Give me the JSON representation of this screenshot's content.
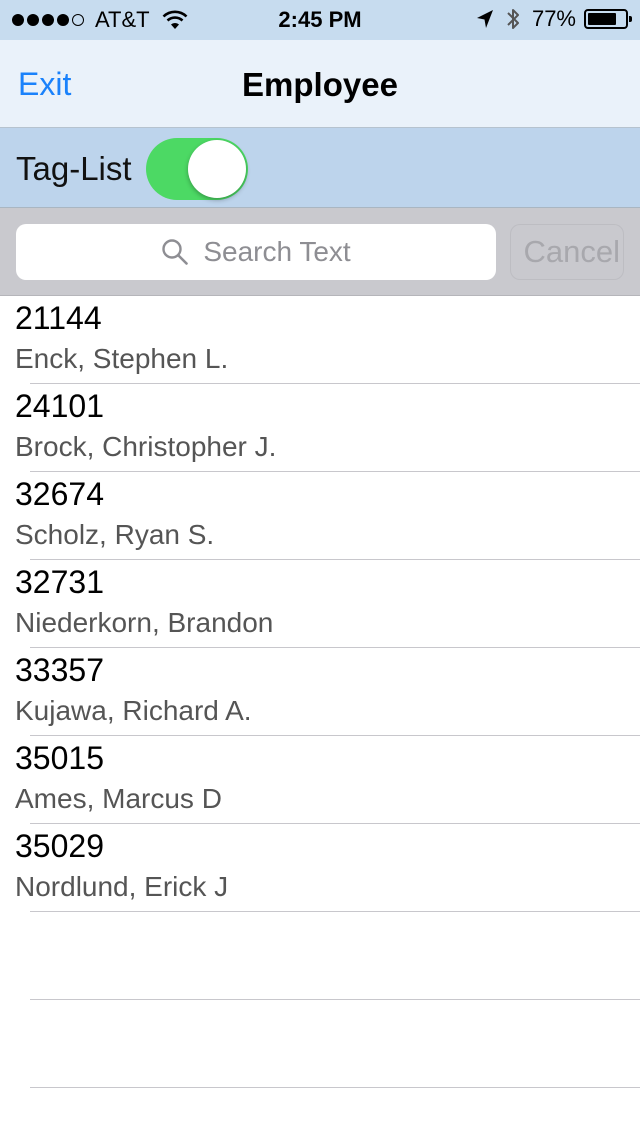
{
  "status_bar": {
    "carrier": "AT&T",
    "signal_bars_filled": 4,
    "signal_bars_total": 5,
    "time": "2:45 PM",
    "battery_percent": "77%",
    "icons": [
      "wifi-icon",
      "location-arrow-icon",
      "bluetooth-icon",
      "battery-icon"
    ]
  },
  "nav": {
    "exit_label": "Exit",
    "title": "Employee"
  },
  "tag_list": {
    "label": "Tag-List",
    "toggle_on": true,
    "toggle_color": "#4cd964"
  },
  "search": {
    "placeholder": "Search Text",
    "cancel_label": "Cancel",
    "icon": "search-icon"
  },
  "employees": [
    {
      "id": "21144",
      "name": "Enck, Stephen L."
    },
    {
      "id": "24101",
      "name": "Brock, Christopher J."
    },
    {
      "id": "32674",
      "name": "Scholz, Ryan S."
    },
    {
      "id": "32731",
      "name": "Niederkorn, Brandon"
    },
    {
      "id": "33357",
      "name": "Kujawa, Richard A."
    },
    {
      "id": "35015",
      "name": "Ames, Marcus D"
    },
    {
      "id": "35029",
      "name": "Nordlund, Erick J"
    }
  ],
  "colors": {
    "accent": "#1a82fb",
    "status_bar_bg": "#c7dcef",
    "nav_bg": "#eaf2fa",
    "tag_bar_bg": "#bdd4ec",
    "search_bar_bg": "#c9c9ce"
  }
}
